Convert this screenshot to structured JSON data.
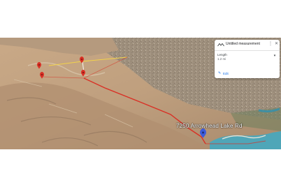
{
  "map": {
    "road_label": "7250 Arrowhead Lake Rd"
  },
  "colors": {
    "measure_line": "#d93025",
    "pin_red": "#d93025",
    "pin_blue": "#3b5bdb",
    "water": "#4fa6b8",
    "terrain": "#c8ab8a"
  },
  "measurement_panel": {
    "title": "Untitled measurement",
    "menu_icon": "more-vert-icon",
    "close_icon": "close-icon",
    "metric_label": "Length",
    "metric_value": "1.2 mi",
    "edit_label": "Edit"
  }
}
